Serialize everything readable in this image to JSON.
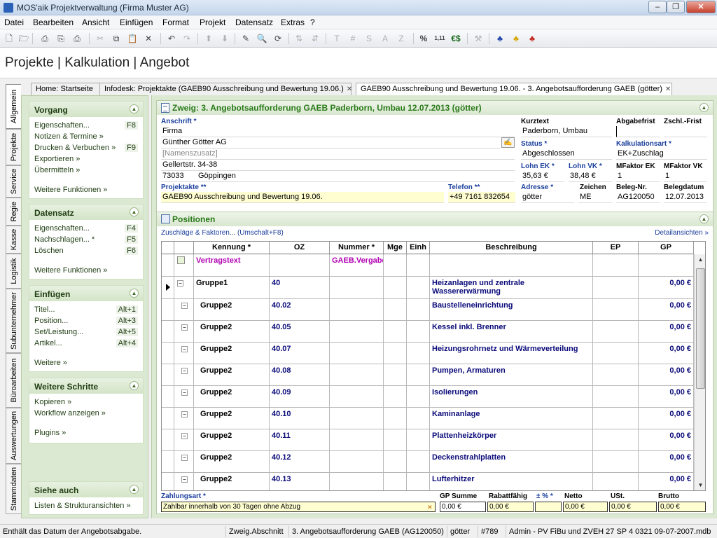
{
  "window": {
    "title": "MOS'aik Projektverwaltung (Firma Muster AG)",
    "minimize": "–",
    "maximize": "❐",
    "close": "✕"
  },
  "menu": [
    "Datei",
    "Bearbeiten",
    "Ansicht",
    "Einfügen",
    "Format",
    "Projekt",
    "Datensatz",
    "Extras",
    "?"
  ],
  "toolbar": {
    "text_tools": [
      "T",
      "#",
      "S",
      "A",
      "Z"
    ],
    "percent": "%",
    "numbers": "1,11",
    "currency": "€$"
  },
  "page_title": "Projekte | Kalkulation | Angebot",
  "vtabs": [
    "Allgemein",
    "Projekte",
    "Service",
    "Regie",
    "Kasse",
    "Logistik",
    "Subunternehmer",
    "Büroarbeiten",
    "Auswertungen",
    "Stammdaten"
  ],
  "doc_tabs": [
    "Home: Startseite",
    "Infodesk: Projektakte (GAEB90 Ausschreibung und Bewertung 19.06.)",
    "GAEB90 Ausschreibung und Bewertung 19.06. - 3. Angebotsaufforderung GAEB (götter)"
  ],
  "tab_close": "✕",
  "collapse_glyph": "▲",
  "sidebar": {
    "vorgang": {
      "title": "Vorgang",
      "items": [
        {
          "label": "Eigenschaften...",
          "key": "F8"
        },
        {
          "label": "Notizen & Termine »",
          "key": ""
        },
        {
          "label": "Drucken & Verbuchen »",
          "key": "F9"
        },
        {
          "label": "Exportieren »",
          "key": ""
        },
        {
          "label": "Übermitteln »",
          "key": ""
        }
      ],
      "more": "Weitere Funktionen »"
    },
    "datensatz": {
      "title": "Datensatz",
      "items": [
        {
          "label": "Eigenschaften...",
          "key": "F4"
        },
        {
          "label": "Nachschlagen... *",
          "key": "F5"
        },
        {
          "label": "Löschen",
          "key": "F6"
        }
      ],
      "more": "Weitere Funktionen »"
    },
    "einfuegen": {
      "title": "Einfügen",
      "items": [
        {
          "label": "Titel...",
          "key": "Alt+1"
        },
        {
          "label": "Position...",
          "key": "Alt+3"
        },
        {
          "label": "Set/Leistung...",
          "key": "Alt+5"
        },
        {
          "label": "Artikel...",
          "key": "Alt+4"
        }
      ],
      "more": "Weitere »"
    },
    "schritte": {
      "title": "Weitere Schritte",
      "items": [
        "Kopieren »",
        "Workflow anzeigen »"
      ],
      "plugins": "Plugins »"
    },
    "siehe": {
      "title": "Siehe auch",
      "items": [
        "Listen & Strukturansichten »"
      ]
    }
  },
  "zweig": {
    "title": "Zweig: 3. Angebotsaufforderung GAEB Paderborn, Umbau 12.07.2013 (götter)",
    "anschrift_label": "Anschrift *",
    "anschrift": [
      "Firma",
      "Günther Götter AG",
      "[Namenszusatz]",
      "Gellertstr. 34-38"
    ],
    "plz": "73033",
    "ort": "Göppingen",
    "projektakte_label": "Projektakte **",
    "projektakte": "GAEB90 Ausschreibung und Bewertung 19.06.",
    "telefon_label": "Telefon **",
    "telefon": "+49 7161 832654",
    "kurztext_label": "Kurztext",
    "kurztext": "Paderborn, Umbau",
    "abgabefrist_label": "Abgabefrist",
    "abgabefrist": "",
    "zschl_label": "Zschl.-Frist",
    "zschl": "",
    "status_label": "Status *",
    "status": "Abgeschlossen",
    "kalkart_label": "Kalkulationsart *",
    "kalkart": "EK+Zuschlag",
    "lohn_ek_label": "Lohn EK *",
    "lohn_ek": "35,63 €",
    "lohn_vk_label": "Lohn VK *",
    "lohn_vk": "38,48 €",
    "mfaktor_ek_label": "MFaktor EK",
    "mfaktor_ek": "1",
    "mfaktor_vk_label": "MFaktor VK",
    "mfaktor_vk": "1",
    "adresse_label": "Adresse *",
    "adresse": "götter",
    "zeichen_label": "Zeichen",
    "zeichen": "ME",
    "belegnr_label": "Beleg-Nr.",
    "belegnr": "AG120050",
    "belegdatum_label": "Belegdatum",
    "belegdatum": "12.07.2013"
  },
  "positionen": {
    "title": "Positionen",
    "zuschlaege_link": "Zuschläge & Faktoren... (Umschalt+F8)",
    "details_link": "Detailansichten »",
    "columns": [
      "Kennung *",
      "OZ",
      "Nummer *",
      "Mge",
      "Einh",
      "Beschreibung",
      "EP",
      "GP"
    ],
    "rows": [
      {
        "kennung": "Vertragstext",
        "oz": "",
        "nummer": "GAEB.Vergabe",
        "beschreibung": "",
        "gp": "",
        "kind": "text"
      },
      {
        "kennung": "Gruppe1",
        "oz": "40",
        "nummer": "",
        "beschreibung": "Heizanlagen und zentrale Wassererwärmung",
        "gp": "0,00 €",
        "kind": "g1"
      },
      {
        "kennung": "Gruppe2",
        "oz": "40.02",
        "nummer": "",
        "beschreibung": "Baustelleneinrichtung",
        "gp": "0,00 €",
        "kind": "g2"
      },
      {
        "kennung": "Gruppe2",
        "oz": "40.05",
        "nummer": "",
        "beschreibung": "Kessel inkl. Brenner",
        "gp": "0,00 €",
        "kind": "g2"
      },
      {
        "kennung": "Gruppe2",
        "oz": "40.07",
        "nummer": "",
        "beschreibung": "Heizungsrohrnetz und Wärmeverteilung",
        "gp": "0,00 €",
        "kind": "g2"
      },
      {
        "kennung": "Gruppe2",
        "oz": "40.08",
        "nummer": "",
        "beschreibung": "Pumpen, Armaturen",
        "gp": "0,00 €",
        "kind": "g2"
      },
      {
        "kennung": "Gruppe2",
        "oz": "40.09",
        "nummer": "",
        "beschreibung": "Isolierungen",
        "gp": "0,00 €",
        "kind": "g2"
      },
      {
        "kennung": "Gruppe2",
        "oz": "40.10",
        "nummer": "",
        "beschreibung": "Kaminanlage",
        "gp": "0,00 €",
        "kind": "g2"
      },
      {
        "kennung": "Gruppe2",
        "oz": "40.11",
        "nummer": "",
        "beschreibung": "Plattenheizkörper",
        "gp": "0,00 €",
        "kind": "g2"
      },
      {
        "kennung": "Gruppe2",
        "oz": "40.12",
        "nummer": "",
        "beschreibung": "Deckenstrahlplatten",
        "gp": "0,00 €",
        "kind": "g2"
      },
      {
        "kennung": "Gruppe2",
        "oz": "40.13",
        "nummer": "",
        "beschreibung": "Lufterhitzer",
        "gp": "0,00 €",
        "kind": "g2"
      }
    ],
    "zahlungsart_label": "Zahlungsart *",
    "zahlungsart": "Zahlbar innerhalb von 30 Tagen ohne Abzug",
    "gp_summe_label": "GP Summe",
    "gp_summe": "0,00 €",
    "rabattfaehig_label": "Rabattfähig",
    "rabattfaehig": "0,00 €",
    "prozent_label": "± % *",
    "prozent": "",
    "netto_label": "Netto",
    "netto": "0,00 €",
    "ust_label": "USt.",
    "ust": "0,00 €",
    "brutto_label": "Brutto",
    "brutto": "0,00 €"
  },
  "statusbar": {
    "hint": "Enthält das Datum der Angebotsabgabe.",
    "context": "Zweig.Abschnitt",
    "record": "3. Angebotsaufforderung GAEB (AG120050)",
    "user": "götter",
    "number": "#789",
    "db": "Admin - PV FiBu und ZVEH 27 SP 4 0321 09-07-2007.mdb"
  },
  "colors": {
    "accent_green": "#2a7a1a",
    "label_blue": "#1a3e9c",
    "row_blue": "#0a0a7a",
    "purple": "#b000b0",
    "panel_green": "#dbe8d2"
  }
}
